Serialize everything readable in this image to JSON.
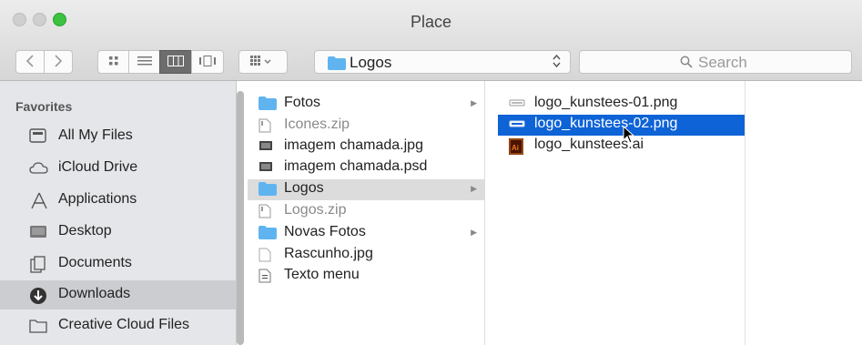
{
  "window": {
    "title": "Place"
  },
  "toolbar": {
    "back_icon": "chevron-left-icon",
    "forward_icon": "chevron-right-icon",
    "view_modes": [
      "icon-view-icon",
      "list-view-icon",
      "column-view-icon",
      "coverflow-view-icon"
    ],
    "active_view": "column-view-icon",
    "arrange_icon": "arrange-grid-icon",
    "path_folder": "Logos",
    "search_placeholder": "Search"
  },
  "sidebar": {
    "heading": "Favorites",
    "items": [
      {
        "label": "All My Files",
        "icon": "all-files-icon",
        "selected": false
      },
      {
        "label": "iCloud Drive",
        "icon": "cloud-icon",
        "selected": false
      },
      {
        "label": "Applications",
        "icon": "applications-icon",
        "selected": false
      },
      {
        "label": "Desktop",
        "icon": "desktop-icon",
        "selected": false
      },
      {
        "label": "Documents",
        "icon": "documents-icon",
        "selected": false
      },
      {
        "label": "Downloads",
        "icon": "downloads-icon",
        "selected": true
      },
      {
        "label": "Creative Cloud Files",
        "icon": "folder-icon",
        "selected": false
      }
    ]
  },
  "column1": {
    "items": [
      {
        "label": "Fotos",
        "type": "folder",
        "has_children": true,
        "dim": false,
        "selected": false
      },
      {
        "label": "Icones.zip",
        "type": "zip",
        "has_children": false,
        "dim": true,
        "selected": false
      },
      {
        "label": "imagem chamada.jpg",
        "type": "image",
        "has_children": false,
        "dim": false,
        "selected": false
      },
      {
        "label": "imagem chamada.psd",
        "type": "image",
        "has_children": false,
        "dim": false,
        "selected": false
      },
      {
        "label": "Logos",
        "type": "folder",
        "has_children": true,
        "dim": false,
        "selected": true
      },
      {
        "label": "Logos.zip",
        "type": "zip",
        "has_children": false,
        "dim": true,
        "selected": false
      },
      {
        "label": "Novas Fotos",
        "type": "folder",
        "has_children": true,
        "dim": false,
        "selected": false
      },
      {
        "label": "Rascunho.jpg",
        "type": "blank",
        "has_children": false,
        "dim": false,
        "selected": false
      },
      {
        "label": "Texto menu",
        "type": "doc",
        "has_children": false,
        "dim": false,
        "selected": false
      }
    ]
  },
  "column2": {
    "items": [
      {
        "label": "logo_kunstees-01.png",
        "type": "png",
        "selected": false
      },
      {
        "label": "logo_kunstees-02.png",
        "type": "png",
        "selected": true
      },
      {
        "label": "logo_kunstees.ai",
        "type": "ai",
        "selected": false
      }
    ]
  },
  "colors": {
    "selection_blue": "#0e63d6",
    "folder_blue": "#5fb4f0",
    "sidebar_bg": "#e4e6e9"
  }
}
